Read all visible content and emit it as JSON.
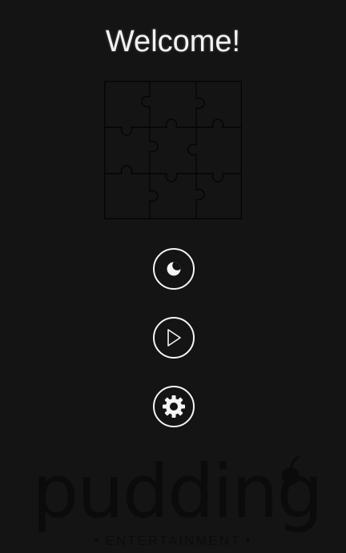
{
  "screen": {
    "title": "Welcome!",
    "background": "#141414"
  },
  "puzzle": {
    "icon": "puzzle-grid-icon",
    "rows": 3,
    "cols": 3
  },
  "menu": {
    "buttons": [
      {
        "name": "theme-toggle-button",
        "icon": "contrast-icon"
      },
      {
        "name": "play-button",
        "icon": "play-icon"
      },
      {
        "name": "settings-button",
        "icon": "gear-icon"
      }
    ],
    "button_stroke_color": "#f5f5f5"
  },
  "brand": {
    "logo_text": "pudding",
    "subtitle": "ENTERTAINMENT",
    "subtitle_separator": "•",
    "logo_color": "#0b0b0b"
  }
}
